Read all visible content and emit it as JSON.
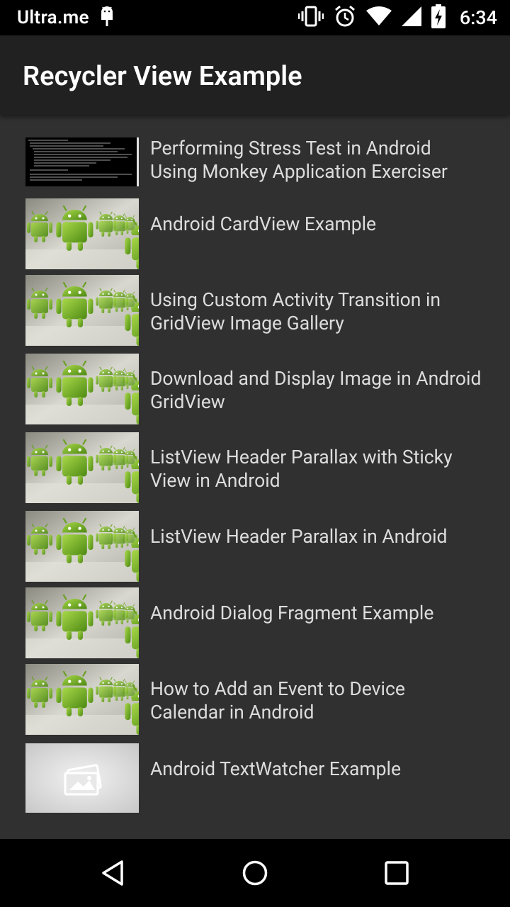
{
  "status_bar": {
    "carrier": "Ultra.me",
    "time": "6:34",
    "icons": [
      "android-debug-icon",
      "vibrate-icon",
      "alarm-icon",
      "wifi-icon",
      "signal-icon",
      "battery-charging-icon"
    ]
  },
  "app_bar": {
    "title": "Recycler View Example"
  },
  "list": {
    "items": [
      {
        "title": "Performing Stress Test in Android Using Monkey Application Exerciser",
        "thumb": "terminal-screenshot"
      },
      {
        "title": "Android CardView Example",
        "thumb": "android-robots"
      },
      {
        "title": "Using Custom Activity Transition in GridView Image Gallery",
        "thumb": "android-robots"
      },
      {
        "title": "Download and Display Image in Android GridView",
        "thumb": "android-robots"
      },
      {
        "title": "ListView Header Parallax with Sticky View in Android",
        "thumb": "android-robots"
      },
      {
        "title": "ListView Header Parallax in Android",
        "thumb": "android-robots"
      },
      {
        "title": "Android Dialog Fragment Example",
        "thumb": "android-robots"
      },
      {
        "title": "How to Add an Event to Device Calendar in Android",
        "thumb": "android-robots"
      },
      {
        "title": "Android TextWatcher Example",
        "thumb": "image-placeholder"
      }
    ]
  },
  "nav_bar": {
    "buttons": [
      "back-icon",
      "home-icon",
      "recents-icon"
    ]
  },
  "colors": {
    "background": "#303030",
    "app_bar": "#212121",
    "status_bar": "#000000",
    "android_green": "#7fb72a"
  }
}
